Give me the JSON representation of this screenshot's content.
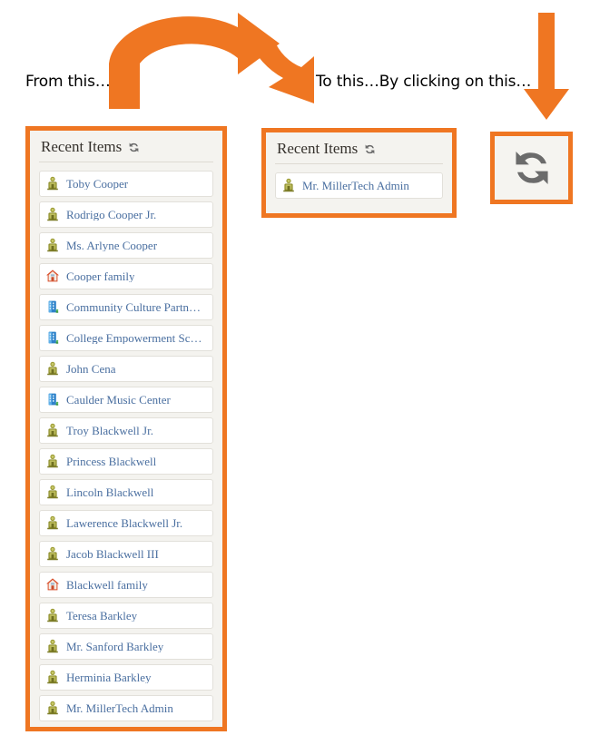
{
  "annotations": {
    "from_label": "From this…",
    "to_label": "To this…By clicking on this…",
    "curved_arrow_icon": "curved-arrow-right-icon",
    "down_arrow_middle_icon": "down-arrow-icon",
    "down_arrow_right_icon": "down-arrow-icon"
  },
  "colors": {
    "accent_orange": "#ef7622",
    "panel_background": "#f4f3ef",
    "row_background": "#ffffff",
    "row_border": "#e2e0da",
    "link_text": "#4a6fa0",
    "title_text": "#35312c",
    "refresh_icon": "#6b6b6b",
    "person_icon": "#8f8f3c",
    "house_icon": "#d94f2b",
    "organization_icon": "#2f82c9"
  },
  "panel_full": {
    "title": "Recent Items",
    "refresh_icon": "refresh-icon",
    "items": [
      {
        "label": "Toby Cooper",
        "icon": "person-icon"
      },
      {
        "label": "Rodrigo Cooper Jr.",
        "icon": "person-icon"
      },
      {
        "label": "Ms. Arlyne Cooper",
        "icon": "person-icon"
      },
      {
        "label": "Cooper family",
        "icon": "house-icon"
      },
      {
        "label": "Community Culture Partn…",
        "icon": "organization-icon"
      },
      {
        "label": "College Empowerment Sc…",
        "icon": "organization-icon"
      },
      {
        "label": "John Cena",
        "icon": "person-icon"
      },
      {
        "label": "Caulder Music Center",
        "icon": "organization-icon"
      },
      {
        "label": "Troy Blackwell Jr.",
        "icon": "person-icon"
      },
      {
        "label": "Princess Blackwell",
        "icon": "person-icon"
      },
      {
        "label": "Lincoln Blackwell",
        "icon": "person-icon"
      },
      {
        "label": "Lawerence Blackwell Jr.",
        "icon": "person-icon"
      },
      {
        "label": "Jacob Blackwell III",
        "icon": "person-icon"
      },
      {
        "label": "Blackwell family",
        "icon": "house-icon"
      },
      {
        "label": "Teresa Barkley",
        "icon": "person-icon"
      },
      {
        "label": "Mr. Sanford Barkley",
        "icon": "person-icon"
      },
      {
        "label": "Herminia Barkley",
        "icon": "person-icon"
      },
      {
        "label": "Mr. MillerTech Admin",
        "icon": "person-icon"
      }
    ]
  },
  "panel_single": {
    "title": "Recent Items",
    "refresh_icon": "refresh-icon",
    "items": [
      {
        "label": "Mr. MillerTech Admin",
        "icon": "person-icon"
      }
    ]
  },
  "refresh_button": {
    "icon": "refresh-icon"
  }
}
